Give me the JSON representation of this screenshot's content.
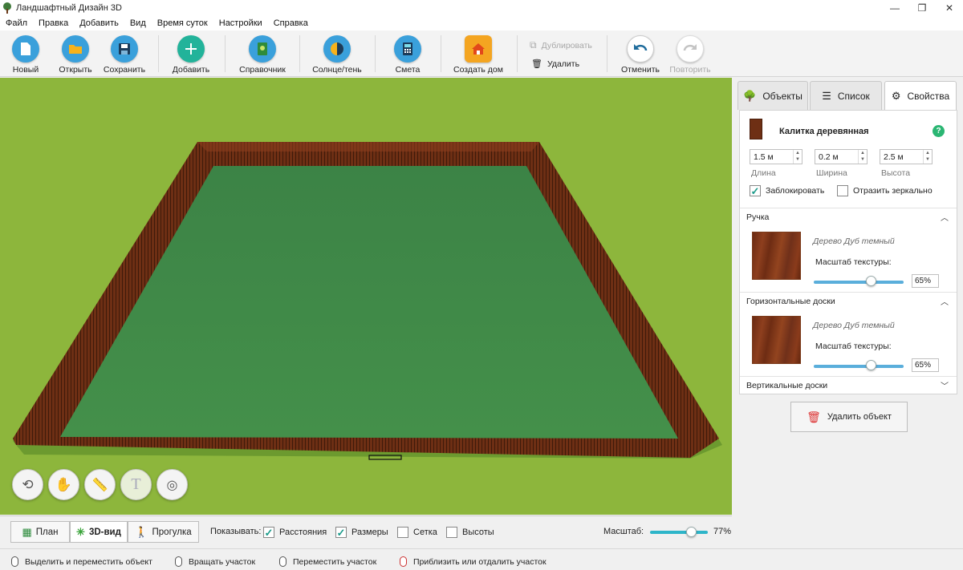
{
  "window": {
    "title": "Ландшафтный Дизайн 3D",
    "minimize": "—",
    "maximize": "❐",
    "close": "✕"
  },
  "menu": [
    "Файл",
    "Правка",
    "Добавить",
    "Вид",
    "Время суток",
    "Настройки",
    "Справка"
  ],
  "toolbar": {
    "new": "Новый",
    "open": "Открыть",
    "save": "Сохранить",
    "add": "Добавить",
    "reference": "Справочник",
    "sun_shade": "Солнце/тень",
    "estimate": "Смета",
    "create_house": "Создать дом",
    "duplicate": "Дублировать",
    "delete": "Удалить",
    "undo": "Отменить",
    "redo": "Повторить"
  },
  "view_modes": {
    "plan": "План",
    "view3d": "3D-вид",
    "walk": "Прогулка",
    "active": "3D-вид"
  },
  "show": {
    "label": "Показывать:",
    "distances": {
      "label": "Расстояния",
      "checked": true
    },
    "sizes": {
      "label": "Размеры",
      "checked": true
    },
    "grid": {
      "label": "Сетка",
      "checked": false
    },
    "heights": {
      "label": "Высоты",
      "checked": false
    }
  },
  "zoom": {
    "label": "Масштаб:",
    "value": "77%",
    "level": 0.77
  },
  "status": {
    "select": "Выделить и переместить объект",
    "rotate": "Вращать участок",
    "move": "Переместить участок",
    "zoom": "Приблизить или отдалить участок"
  },
  "tabs": {
    "objects": "Объекты",
    "list": "Список",
    "properties": "Свойства",
    "active": "Свойства"
  },
  "properties": {
    "object_name": "Калитка деревянная",
    "help": "?",
    "length": {
      "value": "1.5 м",
      "label": "Длина"
    },
    "width": {
      "value": "0.2 м",
      "label": "Ширина"
    },
    "height": {
      "value": "2.5 м",
      "label": "Высота"
    },
    "lock": {
      "label": "Заблокировать",
      "checked": true
    },
    "mirror": {
      "label": "Отразить зеркально",
      "checked": false
    },
    "sections": [
      {
        "title": "Ручка",
        "material": "Дерево Дуб темный",
        "scale_label": "Масштаб текстуры:",
        "scale_value": "65%",
        "scale": 0.65,
        "expanded": true
      },
      {
        "title": "Горизонтальные доски",
        "material": "Дерево Дуб темный",
        "scale_label": "Масштаб текстуры:",
        "scale_value": "65%",
        "scale": 0.65,
        "expanded": true
      },
      {
        "title": "Вертикальные доски",
        "expanded": false
      }
    ],
    "delete_object": "Удалить объект"
  },
  "colors": {
    "grass": "#8db63c",
    "lawn": "#3f8a46",
    "fence": "#6e2f14",
    "accent": "#2eb5c9"
  }
}
